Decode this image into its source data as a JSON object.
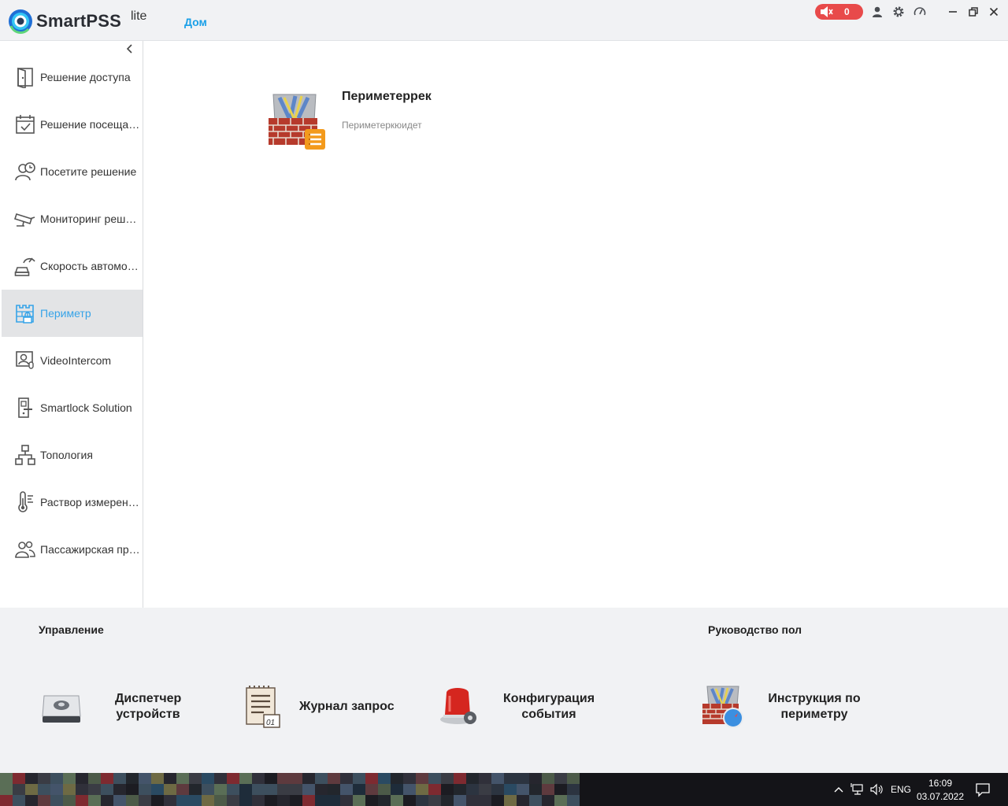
{
  "header": {
    "brand": "SmartPSS",
    "brand_suffix": "lite",
    "home_tab": "Дом",
    "alarm_count": "0"
  },
  "sidebar": {
    "items": [
      {
        "label": "Решение доступа",
        "icon": "door-icon"
      },
      {
        "label": "Решение посещаемости",
        "icon": "calendar-check-icon"
      },
      {
        "label": "Посетите решение",
        "icon": "visitor-clock-icon"
      },
      {
        "label": "Мониторинг решение",
        "icon": "camera-icon"
      },
      {
        "label": "Скорость автомобиля",
        "icon": "speed-car-icon"
      },
      {
        "label": "Периметр",
        "icon": "perimeter-icon",
        "active": true
      },
      {
        "label": "VideoIntercom",
        "icon": "intercom-icon"
      },
      {
        "label": "Smartlock Solution",
        "icon": "smartlock-icon"
      },
      {
        "label": "Топология",
        "icon": "topology-icon"
      },
      {
        "label": "Раствор измерения температуры",
        "icon": "thermometer-icon"
      },
      {
        "label": "Пассажирская проходка",
        "icon": "passengers-icon"
      }
    ]
  },
  "main": {
    "card_title": "Периметеррек",
    "card_subtitle": "Периметеркюидет"
  },
  "bottom": {
    "management_title": "Управление",
    "guide_title": "Руководство пол",
    "tools": [
      {
        "label": "Диспетчер устройств",
        "icon": "device-manager-icon"
      },
      {
        "label": "Журнал запрос",
        "icon": "log-query-icon"
      },
      {
        "label": "Конфигурация события",
        "icon": "event-config-icon"
      },
      {
        "label": "Инструкция по периметру",
        "icon": "perimeter-guide-icon"
      }
    ]
  },
  "taskbar": {
    "language": "ENG",
    "time": "16:09",
    "date": "03.07.2022"
  },
  "colors": {
    "accent": "#1aa0e8",
    "alarm": "#e84a4a",
    "active_bg": "#e3e4e6"
  }
}
